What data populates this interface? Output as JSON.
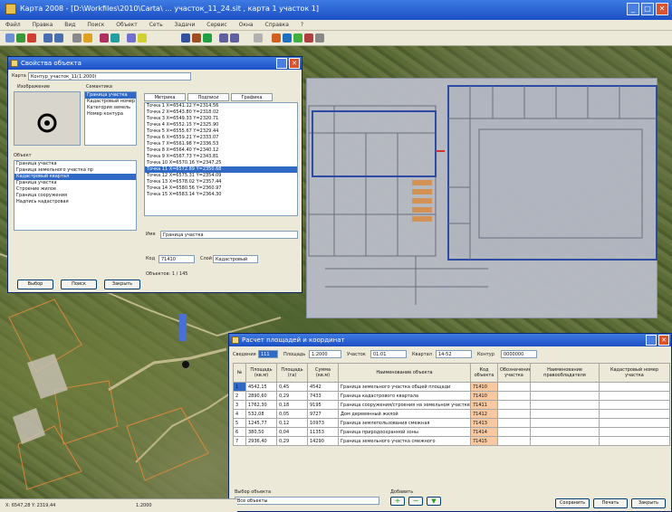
{
  "app": {
    "title": "Карта 2008 - [D:\\Workfiles\\2010\\Carta\\ ... участок_11_24.sit , карта 1 участок 1]",
    "menu": [
      "Файл",
      "Правка",
      "Вид",
      "Поиск",
      "Объект",
      "Сеть",
      "Задачи",
      "Сервис",
      "Окна",
      "Справка",
      "?"
    ]
  },
  "objectPanel": {
    "title": "Свойства объекта",
    "map_label": "Карта",
    "map_value": "Контур_участок_11(1:2000)",
    "image_label": "Изображение",
    "semantics_label": "Семантика",
    "tabs": [
      "Метрика",
      "Подписи",
      "Графика"
    ],
    "object_list_label": "Объект",
    "object_list": [
      "Граница участка",
      "Граница земельного участка пр",
      "Кадастровый квартал",
      "Граница участка",
      "Строение жилое",
      "Граница сооружения",
      "Надпись кадастровая"
    ],
    "object_list_selected": 2,
    "semantics_list": [
      "Граница участка",
      "Кадастровый номер",
      "Категория земель",
      "Номер контура",
      "Площадь",
      "Тип участка",
      "Адрес"
    ],
    "metrics_lines": [
      "Точка 1 X=6541.12 Y=2314.56",
      "Точка 2 X=6543.80 Y=2318.02",
      "Точка 3 X=6549.33 Y=2320.71",
      "Точка 4 X=6552.15 Y=2325.90",
      "Точка 5 X=6555.67 Y=2329.44",
      "Точка 6 X=6559.21 Y=2333.07",
      "Точка 7 X=6561.98 Y=2336.53",
      "Точка 8 X=6564.40 Y=2340.12",
      "Точка 9 X=6567.73 Y=2343.81",
      "Точка 10 X=6570.16 Y=2347.25",
      "Точка 11 X=6572.89 Y=2350.68",
      "Точка 12 X=6575.31 Y=2354.09",
      "Точка 13 X=6578.02 Y=2357.44",
      "Точка 14 X=6580.56 Y=2360.97",
      "Точка 15 X=6583.14 Y=2364.30"
    ],
    "metrics_selected": 10,
    "name_label": "Имя",
    "name_value": "Граница участка",
    "code_label": "Код",
    "code_value": "71410",
    "layer_label": "Слой",
    "layer_value": "Кадастровый",
    "buttons": [
      "Выбор",
      "Поиск",
      "Закрыть"
    ],
    "footer": "Объектов: 1 / 145"
  },
  "tablePanel": {
    "title": "Расчет площадей и координат",
    "filter_labels": [
      "Сведения",
      "Площадь",
      "Участок",
      "Квартал",
      "Контур"
    ],
    "filter_values": [
      "111",
      "1:2000",
      "01:01",
      "14-52",
      "0000000"
    ],
    "columns": [
      "№",
      "Площадь (кв.м)",
      "Площадь (га)",
      "Сумма (кв.м)",
      "Наименование объекта",
      "Код объекта",
      "Обозначение участка",
      "Наименование правообладателя",
      "Кадастровый номер участка"
    ],
    "rows": [
      [
        "1",
        "4542,15",
        "0,45",
        "4542",
        "Граница земельного участка общей площади",
        "71410",
        "",
        "",
        ""
      ],
      [
        "2",
        "2890,60",
        "0,29",
        "7433",
        "Граница кадастрового квартала",
        "71410",
        "",
        "",
        ""
      ],
      [
        "3",
        "1762,30",
        "0,18",
        "9195",
        "Граница сооружения/строения на земельном участке",
        "71411",
        "",
        "",
        ""
      ],
      [
        "4",
        "532,08",
        "0,05",
        "9727",
        "Дом деревянный жилой",
        "71412",
        "",
        "",
        ""
      ],
      [
        "5",
        "1245,77",
        "0,12",
        "10973",
        "Граница землепользования смежная",
        "71413",
        "",
        "",
        ""
      ],
      [
        "6",
        "380,50",
        "0,04",
        "11353",
        "Граница природоохранной зоны",
        "71414",
        "",
        "",
        ""
      ],
      [
        "7",
        "2936,40",
        "0,29",
        "14290",
        "Граница земельного участка смежного",
        "71415",
        "",
        "",
        ""
      ]
    ],
    "selected_row": 0,
    "bottom_label": "Выбор объекта",
    "bottom_value": "Все объекты",
    "add_label": "Добавить",
    "buttons": [
      "Сохранить",
      "Печать",
      "Закрыть"
    ]
  },
  "statusbar": {
    "coords": "X: 6547,28  Y: 2319,44",
    "scale": "1:2000"
  },
  "colors": {
    "titlebar": "#1c4fc4",
    "selection": "#316ac5",
    "highlight": "#f8c8a0",
    "drawing_frame": "#2b4aa8"
  }
}
